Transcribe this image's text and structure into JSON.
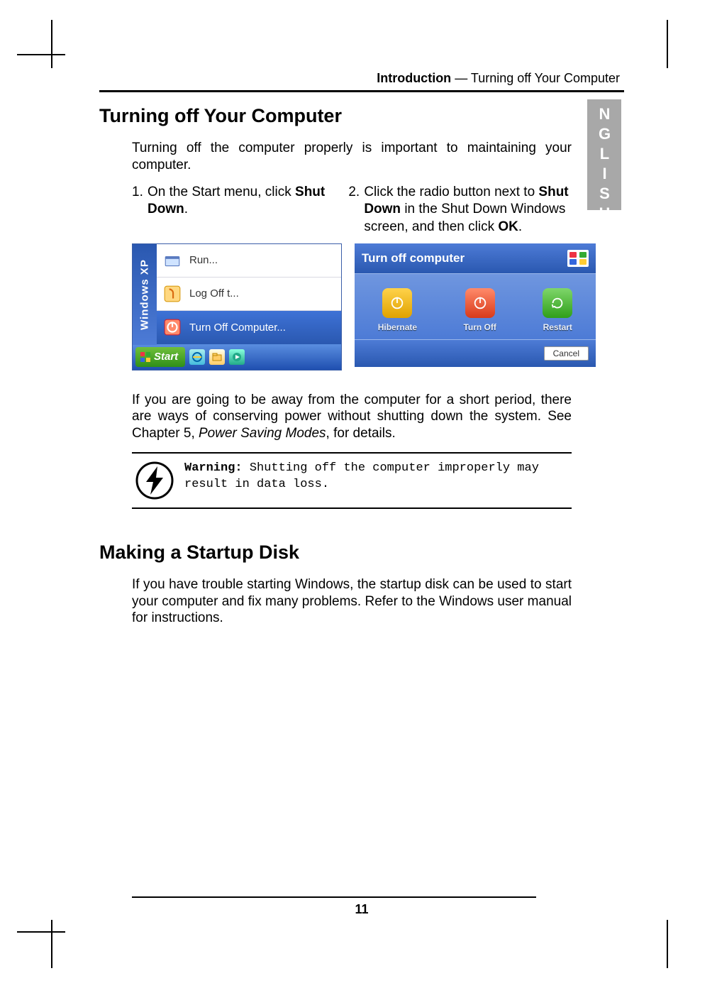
{
  "header": {
    "bold": "Introduction",
    "rest": " — Turning off Your Computer"
  },
  "side_tab": "ENGLISH",
  "section1": {
    "title": "Turning off Your Computer",
    "intro": "Turning off the computer properly is important to maintaining your computer.",
    "step1_pre": "On the Start menu, click ",
    "step1_bold": "Shut Down",
    "step1_post": ".",
    "step2_pre": "Click the radio button next to ",
    "step2_bold": "Shut Down",
    "step2_mid": " in the Shut Down Windows screen, and then click ",
    "step2_bold2": "OK",
    "step2_post": ".",
    "after_pre": "If you are going to be away from the computer for a short period, there are ways of conserving power without shutting down the system. See Chapter 5, ",
    "after_ital": "Power Saving Modes",
    "after_post": ", for details."
  },
  "startmenu": {
    "side": "Windows XP",
    "run": "Run...",
    "logoff": "Log Off t...",
    "turnoff": "Turn Off Computer...",
    "start": "Start"
  },
  "turnoff_dialog": {
    "title": "Turn off computer",
    "hibernate": "Hibernate",
    "turnoff": "Turn Off",
    "restart": "Restart",
    "cancel": "Cancel"
  },
  "warning": {
    "label": "Warning:",
    "text": " Shutting off the computer improperly may result in data loss."
  },
  "section2": {
    "title": "Making a Startup Disk",
    "para": "If you have trouble starting Windows, the startup disk can be used to start your computer and fix many problems. Refer to the Windows user manual for instructions."
  },
  "page_number": "11"
}
